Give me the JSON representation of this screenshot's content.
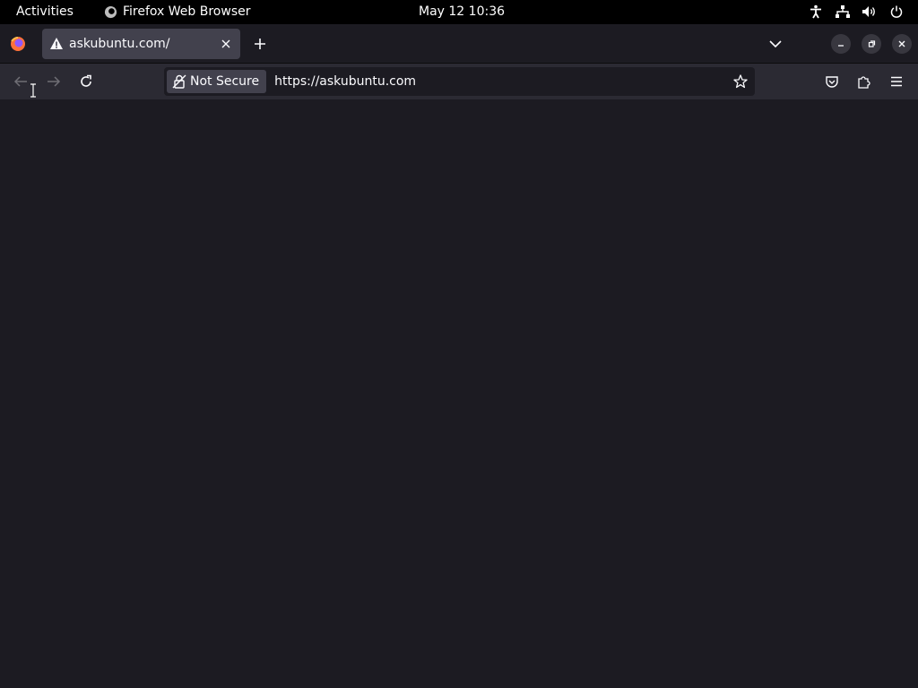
{
  "topbar": {
    "activities_label": "Activities",
    "app_name": "Firefox Web Browser",
    "datetime": "May 12  10:36",
    "tray_icons": [
      "accessibility-icon",
      "network-icon",
      "volume-icon",
      "power-icon"
    ]
  },
  "tabs": [
    {
      "title": "askubuntu.com/",
      "icon": "warning-icon",
      "active": true
    }
  ],
  "navbar": {
    "security_label": "Not Secure",
    "url": "https://askubuntu.com"
  },
  "colors": {
    "topbar_bg": "#000000",
    "tabstrip_bg": "#1c1b22",
    "active_tab_bg": "#42414d",
    "toolbar_bg": "#2b2a33",
    "urlbar_bg": "#1c1b22",
    "content_bg": "#1c1b22",
    "text": "#fbfbfe"
  }
}
